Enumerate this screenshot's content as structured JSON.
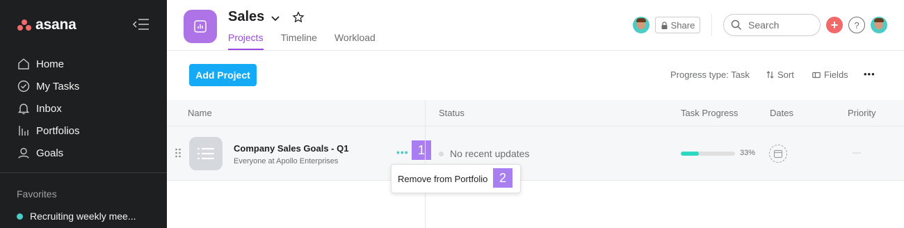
{
  "sidebar": {
    "logo": "asana",
    "nav": [
      {
        "label": "Home",
        "icon": "home-icon"
      },
      {
        "label": "My Tasks",
        "icon": "check-circle-icon"
      },
      {
        "label": "Inbox",
        "icon": "bell-icon"
      },
      {
        "label": "Portfolios",
        "icon": "bar-chart-icon"
      },
      {
        "label": "Goals",
        "icon": "person-icon"
      }
    ],
    "favorites_title": "Favorites",
    "favorites": [
      {
        "label": "Recruiting weekly mee...",
        "color": "#4ecbc4"
      }
    ]
  },
  "header": {
    "title": "Sales",
    "tabs": [
      {
        "label": "Projects",
        "active": true
      },
      {
        "label": "Timeline",
        "active": false
      },
      {
        "label": "Workload",
        "active": false
      }
    ],
    "share_label": "Share",
    "search_placeholder": "Search",
    "plus_label": "+",
    "help_label": "?",
    "accent_color": "#9b45e0"
  },
  "toolbar": {
    "add_project": "Add Project",
    "progress_type": "Progress type: Task",
    "sort": "Sort",
    "fields": "Fields",
    "more": "•••"
  },
  "table": {
    "columns": [
      "Name",
      "Status",
      "Task Progress",
      "Dates",
      "Priority"
    ],
    "rows": [
      {
        "name": "Company Sales Goals - Q1",
        "subtitle": "Everyone at Apollo Enterprises",
        "status": "No recent updates",
        "progress": 0.33,
        "progress_label": "33%",
        "priority": "—"
      }
    ]
  },
  "row_menu": {
    "dots": "•••",
    "item": "Remove from Portfolio"
  },
  "markers": [
    "1",
    "2"
  ]
}
